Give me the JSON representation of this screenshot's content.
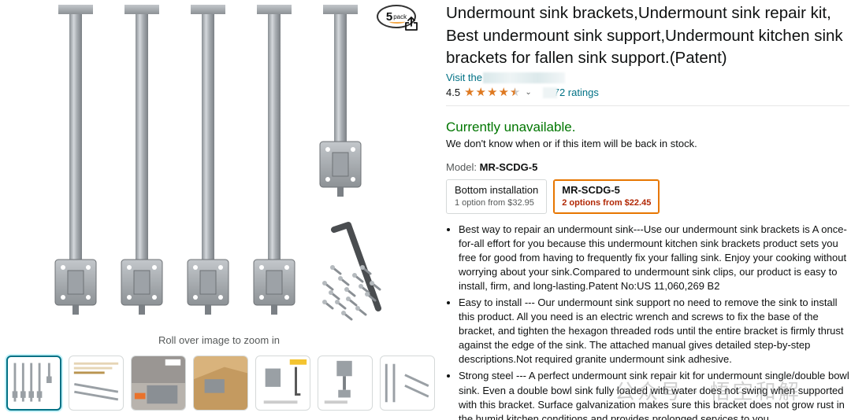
{
  "gallery": {
    "badge": {
      "number": "5",
      "word": "pack"
    },
    "zoom_hint": "Roll over image to zoom in",
    "thumbnails": [
      {
        "name": "thumb-main-brackets",
        "label": ""
      },
      {
        "name": "thumb-dimensions",
        "label": ""
      },
      {
        "name": "thumb-before-after",
        "label": ""
      },
      {
        "name": "thumb-cabinet",
        "label": ""
      },
      {
        "name": "thumb-allen-key",
        "label": ""
      },
      {
        "name": "thumb-turnbuckle",
        "label": ""
      },
      {
        "name": "thumb-size-diagram",
        "label": ""
      }
    ]
  },
  "product": {
    "title": "Undermount sink brackets,Undermount sink repair kit, Best undermount sink support,Undermount kitchen sink brackets for fallen sink support.(Patent)",
    "store_prefix": "Visit the",
    "rating_value": "4.5",
    "stars": [
      "full",
      "full",
      "full",
      "full",
      "half"
    ],
    "ratings_text": "72 ratings",
    "availability": "Currently unavailable.",
    "stock_note": "We don't know when or if this item will be back in stock.",
    "model_label": "Model:",
    "model_value": "MR-SCDG-5",
    "options": [
      {
        "name": "Bottom installation",
        "price": "1 option from $32.95"
      },
      {
        "name": "MR-SCDG-5",
        "price": "2 options from $22.45"
      }
    ],
    "bullets": [
      "Best way to repair an undermount sink---Use our undermount sink brackets is A once-for-all effort for you because this undermount kitchen sink brackets product sets you free for good from having to frequently fix your falling sink. Enjoy your cooking without worrying about your sink.Compared to undermount sink clips, our product is easy to install, firm, and long-lasting.Patent No:US 11,060,269 B2",
      "Easy to install --- Our undermount sink support no need to remove the sink to install this product. All you need is an electric wrench and screws to fix the base of the bracket, and tighten the hexagon threaded rods until the entire bracket is firmly thrust against the edge of the sink. The attached manual gives detailed step-by-step descriptions.Not required granite undermount sink adhesive.",
      "Strong steel --- A perfect undermount sink repair kit for undermount single/double bowl sink. Even a double bowl sink fully loaded with water does not swing when supported with this bracket. Surface galvanization makes sure this bracket does not grow rust in the humid kitchen conditions and provides prolonged services to you."
    ]
  },
  "watermark": "公众号 · 悟空和解",
  "colors": {
    "link": "#007185",
    "available_green": "#007600",
    "star": "#de7921",
    "price_red": "#b12704",
    "selected_border": "#e77600"
  }
}
